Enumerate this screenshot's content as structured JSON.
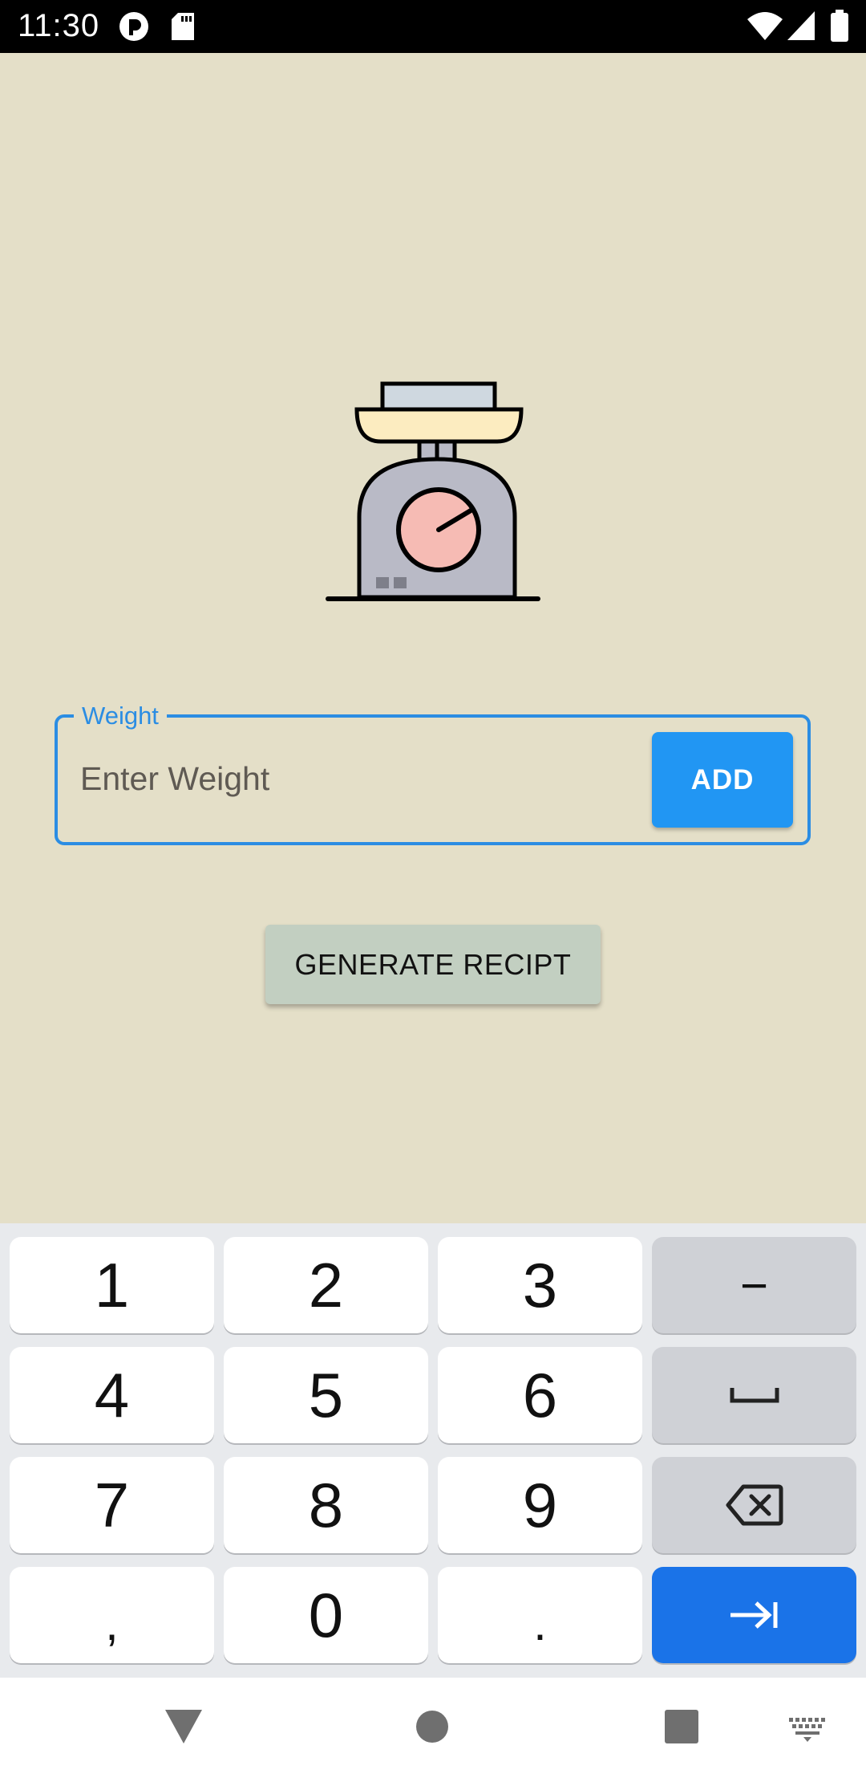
{
  "status_bar": {
    "time": "11:30",
    "icons": [
      "notification-app-icon",
      "sd-card-icon",
      "wifi-icon",
      "cellular-signal-icon",
      "battery-icon"
    ]
  },
  "weight_field": {
    "label": "Weight",
    "placeholder": "Enter Weight",
    "value": ""
  },
  "add_button": {
    "label": "ADD"
  },
  "generate_button": {
    "label": "GENERATE RECIPT"
  },
  "illustration": {
    "icon": "kitchen-scale-icon"
  },
  "keyboard": {
    "keys": [
      "1",
      "2",
      "3",
      "−",
      "4",
      "5",
      "6",
      "space",
      "7",
      "8",
      "9",
      "backspace",
      ",",
      "0",
      ".",
      "next"
    ],
    "labels": {
      "k1": "1",
      "k2": "2",
      "k3": "3",
      "minus": "−",
      "k4": "4",
      "k5": "5",
      "k6": "6",
      "k7": "7",
      "k8": "8",
      "k9": "9",
      "comma": ",",
      "k0": "0",
      "period": "."
    }
  },
  "nav_bar": {
    "icons": [
      "back-icon",
      "home-icon",
      "recents-icon",
      "keyboard-switch-icon"
    ]
  },
  "colors": {
    "background": "#e4dfc8",
    "accent": "#2196f3",
    "field_border": "#2b8de3",
    "generate_button": "#c2cfc1",
    "enter_key": "#1a73e8"
  }
}
